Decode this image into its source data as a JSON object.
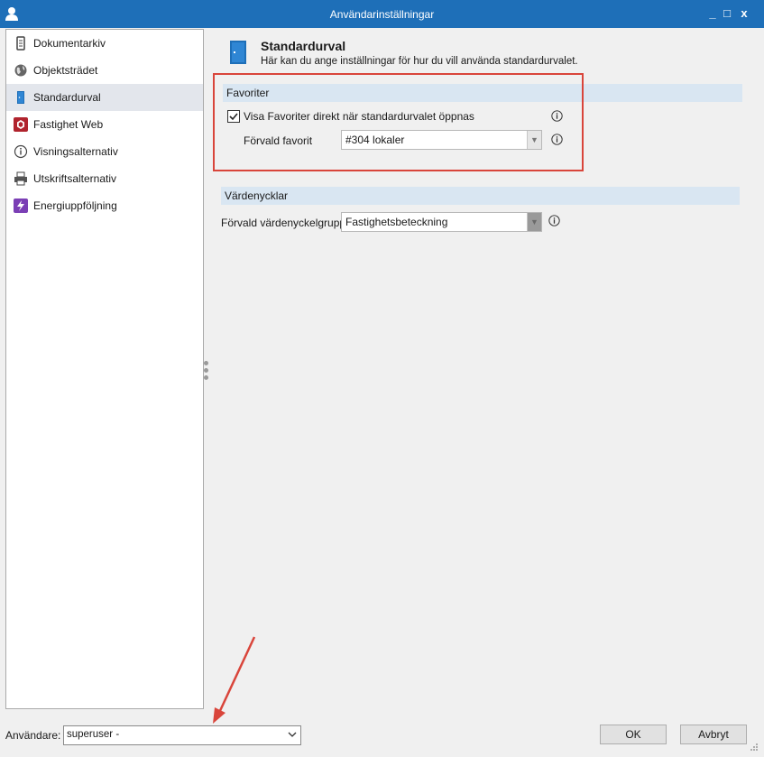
{
  "window": {
    "title": "Användarinställningar",
    "minimize": "_",
    "maximize": "□",
    "close": "x"
  },
  "sidebar": {
    "items": [
      {
        "label": "Dokumentarkiv",
        "icon": "document-archive-icon"
      },
      {
        "label": "Objektsträdet",
        "icon": "globe-icon"
      },
      {
        "label": "Standardurval",
        "icon": "door-icon",
        "active": true
      },
      {
        "label": "Fastighet Web",
        "icon": "hexagon-web-icon"
      },
      {
        "label": "Visningsalternativ",
        "icon": "info-icon"
      },
      {
        "label": "Utskriftsalternativ",
        "icon": "printer-icon"
      },
      {
        "label": "Energiuppföljning",
        "icon": "lightning-icon"
      }
    ]
  },
  "header": {
    "title": "Standardurval",
    "subtitle": "Här kan du ange inställningar för hur du vill använda standardurvalet."
  },
  "favoriter": {
    "section_title": "Favoriter",
    "checkbox_label": "Visa Favoriter direkt när standardurvalet öppnas",
    "checkbox_checked": true,
    "default_label": "Förvald favorit",
    "default_value": "#304 lokaler"
  },
  "vardenycklar": {
    "section_title": "Värdenycklar",
    "group_label": "Förvald värdenyckelgrupp",
    "group_value": "Fastighetsbeteckning"
  },
  "footer": {
    "user_label": "Användare:",
    "user_value": "superuser -",
    "ok_label": "OK",
    "cancel_label": "Avbryt"
  },
  "colors": {
    "titlebar": "#1e6fb8",
    "section": "#d9e6f2",
    "highlight_border": "#d9453b",
    "annotation_arrow": "#d9453b"
  }
}
